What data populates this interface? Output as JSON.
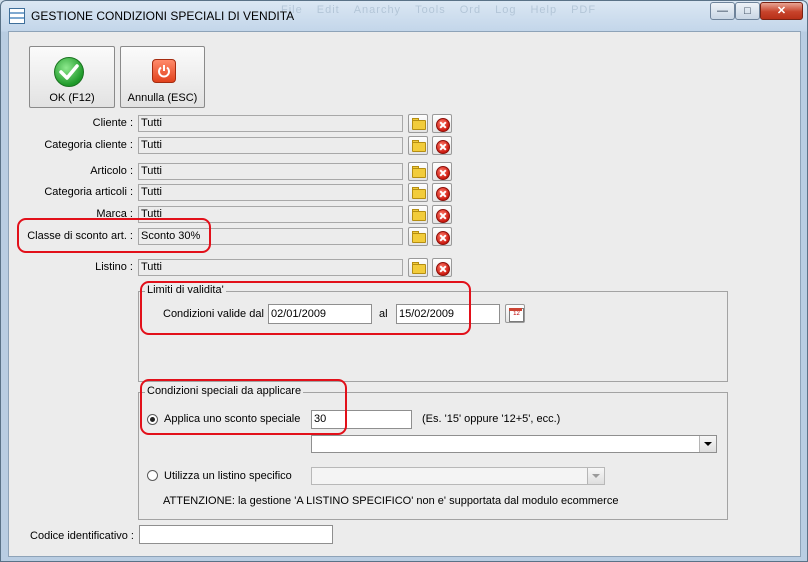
{
  "window": {
    "title": "GESTIONE CONDIZIONI SPECIALI DI VENDITA",
    "ghost_menu": [
      "File",
      "Edit",
      "Anarchy",
      "Tools",
      "Ord",
      "Log",
      "Help",
      "PDF"
    ]
  },
  "toolbar": {
    "ok_label": "OK (F12)",
    "cancel_label": "Annulla (ESC)"
  },
  "filters": [
    {
      "label": "Cliente :",
      "value": "Tutti"
    },
    {
      "label": "Categoria cliente :",
      "value": "Tutti"
    },
    {
      "label": "Articolo :",
      "value": "Tutti"
    },
    {
      "label": "Categoria articoli :",
      "value": "Tutti"
    },
    {
      "label": "Marca :",
      "value": "Tutti"
    },
    {
      "label": "Classe di sconto art. :",
      "value": "Sconto 30%"
    },
    {
      "label": "Listino :",
      "value": "Tutti"
    }
  ],
  "validity": {
    "group_title": "Limiti di validita'",
    "from_label": "Condizioni valide dal",
    "from_value": "02/01/2009",
    "to_label": "al",
    "to_value": "15/02/2009",
    "calendar_text": "12"
  },
  "conditions": {
    "group_title": "Condizioni speciali da applicare",
    "option1_label": "Applica uno sconto speciale",
    "discount_value": "30",
    "discount_hint": "(Es. '15' oppure '12+5', ecc.)",
    "option2_label": "Utilizza un listino specifico",
    "warning": "ATTENZIONE: la gestione 'A LISTINO SPECIFICO' non e' supportata dal modulo ecommerce"
  },
  "code": {
    "label": "Codice identificativo :",
    "value": ""
  },
  "colors": {
    "highlight": "#e2101a"
  }
}
